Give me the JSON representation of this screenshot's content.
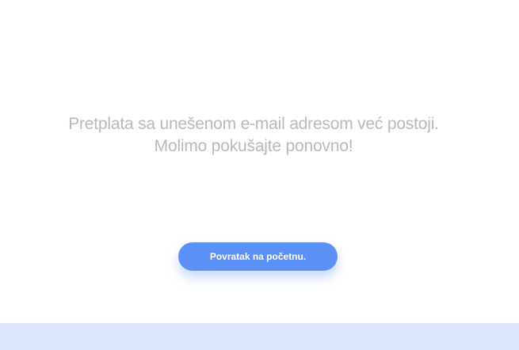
{
  "message": {
    "line1": "Pretplata sa unešenom e-mail adresom već postoji.",
    "line2": "Molimo pokušajte ponovno!"
  },
  "button": {
    "label": "Povratak na početnu."
  },
  "colors": {
    "message_text": "#b9b9b9",
    "button_bg": "#5b90f6",
    "button_text": "#ffffff",
    "footer_band": "#dbe6fe"
  }
}
